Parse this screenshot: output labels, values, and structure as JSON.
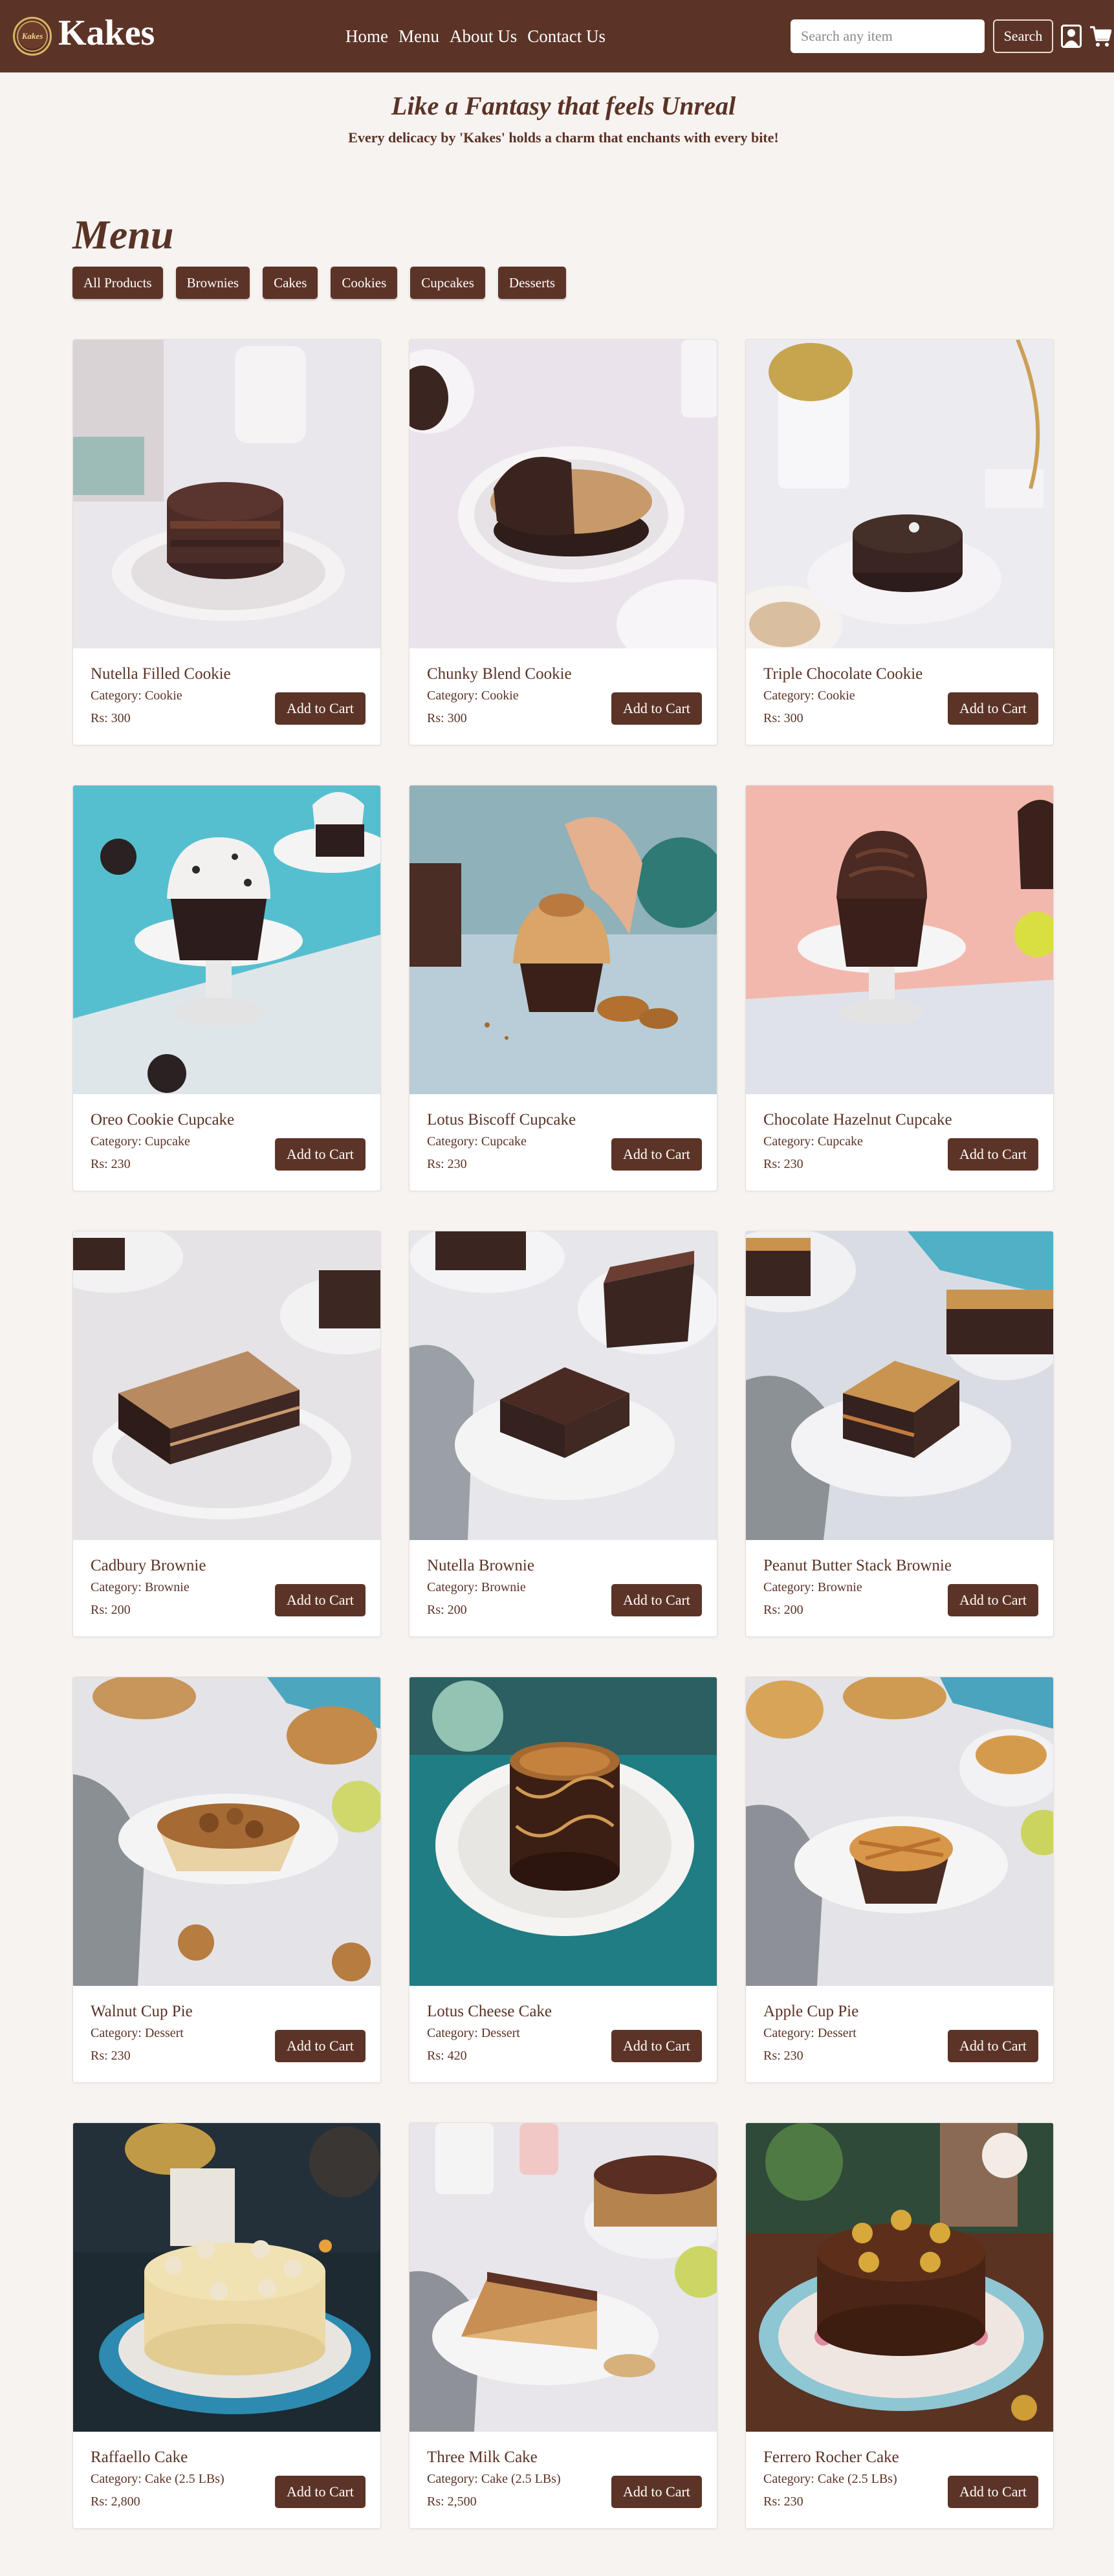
{
  "brand": {
    "name": "Kakes",
    "logo_text": "Kakes"
  },
  "nav": {
    "links": [
      "Home",
      "Menu",
      "About Us",
      "Contact Us"
    ]
  },
  "search": {
    "placeholder": "Search any item",
    "button_label": "Search"
  },
  "icons": {
    "user": "user-icon",
    "cart": "cart-icon"
  },
  "hero": {
    "title": "Like a Fantasy that feels Unreal",
    "subtitle": "Every delicacy by 'Kakes' holds a charm that enchants with every bite!"
  },
  "menu": {
    "title": "Menu",
    "filters": [
      "All Products",
      "Brownies",
      "Cakes",
      "Cookies",
      "Cupcakes",
      "Desserts"
    ]
  },
  "colors": {
    "primary": "#5c3427",
    "background": "#f7f3f1",
    "text": "#5a3326"
  },
  "products": [
    {
      "name": "Nutella Filled Cookie",
      "category": "Category: Cookie",
      "price": "Rs: 300",
      "button": "Add to Cart"
    },
    {
      "name": "Chunky Blend Cookie",
      "category": "Category: Cookie",
      "price": "Rs: 300",
      "button": "Add to Cart"
    },
    {
      "name": "Triple Chocolate Cookie",
      "category": "Category: Cookie",
      "price": "Rs: 300",
      "button": "Add to Cart"
    },
    {
      "name": "Oreo Cookie Cupcake",
      "category": "Category: Cupcake",
      "price": "Rs: 230",
      "button": "Add to Cart"
    },
    {
      "name": "Lotus Biscoff Cupcake",
      "category": "Category: Cupcake",
      "price": "Rs: 230",
      "button": "Add to Cart"
    },
    {
      "name": "Chocolate Hazelnut Cupcake",
      "category": "Category: Cupcake",
      "price": "Rs: 230",
      "button": "Add to Cart"
    },
    {
      "name": "Cadbury Brownie",
      "category": "Category: Brownie",
      "price": "Rs: 200",
      "button": "Add to Cart"
    },
    {
      "name": "Nutella Brownie",
      "category": "Category: Brownie",
      "price": "Rs: 200",
      "button": "Add to Cart"
    },
    {
      "name": "Peanut Butter Stack Brownie",
      "category": "Category: Brownie",
      "price": "Rs: 200",
      "button": "Add to Cart"
    },
    {
      "name": "Walnut Cup Pie",
      "category": "Category: Dessert",
      "price": "Rs: 230",
      "button": "Add to Cart"
    },
    {
      "name": "Lotus Cheese Cake",
      "category": "Category: Dessert",
      "price": "Rs: 420",
      "button": "Add to Cart"
    },
    {
      "name": "Apple Cup Pie",
      "category": "Category: Dessert",
      "price": "Rs: 230",
      "button": "Add to Cart"
    },
    {
      "name": "Raffaello Cake",
      "category": "Category: Cake (2.5 LBs)",
      "price": "Rs: 2,800",
      "button": "Add to Cart"
    },
    {
      "name": "Three Milk Cake",
      "category": "Category: Cake (2.5 LBs)",
      "price": "Rs: 2,500",
      "button": "Add to Cart"
    },
    {
      "name": "Ferrero Rocher Cake",
      "category": "Category: Cake (2.5 LBs)",
      "price": "Rs: 230",
      "button": "Add to Cart"
    }
  ]
}
